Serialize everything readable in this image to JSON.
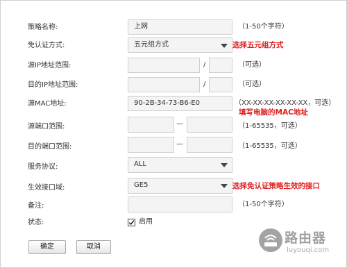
{
  "form": {
    "policy_name": {
      "label": "策略名称:",
      "value": "上网",
      "hint": "（1-50个字符）"
    },
    "auth_free_mode": {
      "label": "免认证方式:",
      "value": "五元组方式",
      "note": "选择五元组方式"
    },
    "src_ip_range": {
      "label": "源IP地址范围:",
      "start": "",
      "end": "",
      "separator": "/",
      "hint": "（可选）"
    },
    "dst_ip_range": {
      "label": "目的IP地址范围:",
      "start": "",
      "end": "",
      "separator": "/",
      "hint": "（可选）"
    },
    "src_mac": {
      "label": "源MAC地址:",
      "value": "90-2B-34-73-B6-E0",
      "hint": "（XX-XX-XX-XX-XX-XX，可选）",
      "note": "填写电脑的MAC地址"
    },
    "src_port_range": {
      "label": "源端口范围:",
      "start": "",
      "end": "",
      "separator": "—",
      "hint": "（1-65535，可选）"
    },
    "dst_port_range": {
      "label": "目的端口范围:",
      "start": "",
      "end": "",
      "separator": "—",
      "hint": "（1-65535，可选）"
    },
    "protocol": {
      "label": "服务协议:",
      "value": "ALL"
    },
    "effective_zone": {
      "label": "生效接口域:",
      "value": "GE5",
      "note": "选择免认证策略生效的接口"
    },
    "remark": {
      "label": "备注:",
      "value": "",
      "hint": "（1-50个字符）"
    },
    "status": {
      "label": "状态:",
      "checkbox_label": "启用",
      "checked": true
    }
  },
  "buttons": {
    "ok": "确定",
    "cancel": "取消"
  },
  "watermark": {
    "title": "路由器",
    "url": "luyouqi.com"
  },
  "colors": {
    "note": "#e02020",
    "field_bg": "#f4f4f4",
    "field_border": "#cfcfcf"
  }
}
